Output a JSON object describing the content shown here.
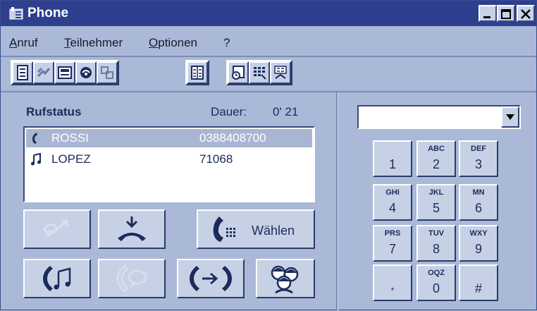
{
  "window": {
    "title": "Phone"
  },
  "menu": [
    "Anruf",
    "Teilnehmer",
    "Optionen",
    "?"
  ],
  "status": {
    "heading": "Rufstatus",
    "duration_label": "Dauer:",
    "duration_value": "0' 21"
  },
  "calls": [
    {
      "name": "ROSSI",
      "number": "0388408700",
      "selected": true,
      "icon": "handset-active-icon"
    },
    {
      "name": "LOPEZ",
      "number": "71068",
      "selected": false,
      "icon": "music-hold-icon"
    }
  ],
  "actions": {
    "dial_label": "Wählen"
  },
  "keypad": [
    {
      "letters": "",
      "digit": "1"
    },
    {
      "letters": "ABC",
      "digit": "2"
    },
    {
      "letters": "DEF",
      "digit": "3"
    },
    {
      "letters": "GHI",
      "digit": "4"
    },
    {
      "letters": "JKL",
      "digit": "5"
    },
    {
      "letters": "MN",
      "digit": "6"
    },
    {
      "letters": "PRS",
      "digit": "7"
    },
    {
      "letters": "TUV",
      "digit": "8"
    },
    {
      "letters": "WXY",
      "digit": "9"
    },
    {
      "letters": "",
      "digit": "*"
    },
    {
      "letters": "OQZ",
      "digit": "0"
    },
    {
      "letters": "",
      "digit": "#"
    }
  ],
  "colors": {
    "title_bar": "#2f3f8f",
    "background": "#a9b9d7",
    "button_face": "#c7d1e6",
    "selection": "#a8b6d3"
  }
}
